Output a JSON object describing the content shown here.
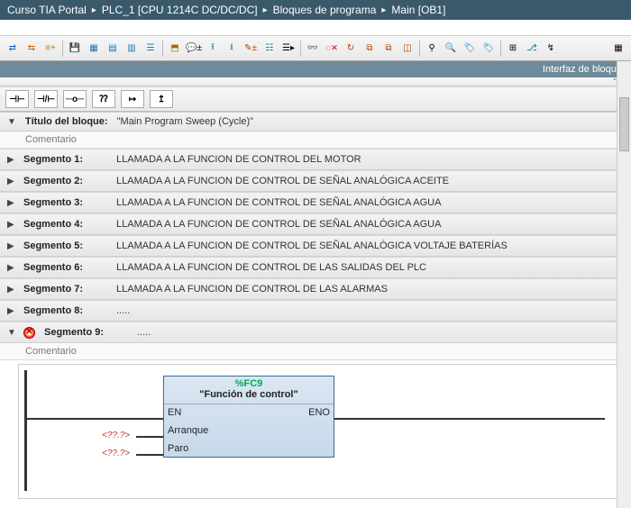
{
  "breadcrumb": {
    "items": [
      "Curso TIA Portal",
      "PLC_1 [CPU 1214C DC/DC/DC]",
      "Bloques de programa",
      "Main [OB1]"
    ]
  },
  "interfacebar": {
    "label": "Interfaz de bloque"
  },
  "instr_buttons": [
    "⊣⊢",
    "⊣/⊢",
    "─o─",
    "⁇",
    "↦",
    "↥"
  ],
  "block_title": {
    "label": "Título del bloque:",
    "value": "\"Main Program Sweep (Cycle)\"",
    "comment": "Comentario"
  },
  "segments": [
    {
      "name": "Segmento 1:",
      "desc": "LLAMADA A LA FUNCION DE CONTROL DEL  MOTOR",
      "expanded": false,
      "error": false
    },
    {
      "name": "Segmento 2:",
      "desc": "LLAMADA A LA FUNCION DE CONTROL DE SEÑAL ANALÓGICA ACEITE",
      "expanded": false,
      "error": false
    },
    {
      "name": "Segmento 3:",
      "desc": "LLAMADA A LA FUNCION DE CONTROL DE SEÑAL ANALÓGICA AGUA",
      "expanded": false,
      "error": false
    },
    {
      "name": "Segmento 4:",
      "desc": "LLAMADA A LA FUNCION DE CONTROL DE SEÑAL ANALÓGICA AGUA",
      "expanded": false,
      "error": false
    },
    {
      "name": "Segmento 5:",
      "desc": "LLAMADA A LA FUNCION DE CONTROL DE SEÑAL ANALÓGICA VOLTAJE BATERÍAS",
      "expanded": false,
      "error": false
    },
    {
      "name": "Segmento 6:",
      "desc": "LLAMADA A LA FUNCION DE CONTROL DE LAS SALIDAS DEL PLC",
      "expanded": false,
      "error": false
    },
    {
      "name": "Segmento 7:",
      "desc": "LLAMADA A LA FUNCION DE CONTROL DE LAS ALARMAS",
      "expanded": false,
      "error": false
    },
    {
      "name": "Segmento 8:",
      "desc": ".....",
      "expanded": false,
      "error": false
    },
    {
      "name": "Segmento 9:",
      "desc": ".....",
      "expanded": true,
      "error": true,
      "comment": "Comentario"
    }
  ],
  "fbd": {
    "symref": "%FC9",
    "title": "\"Función de control\"",
    "ports_left": [
      "EN",
      "Arranque",
      "Paro"
    ],
    "ports_right": [
      "ENO"
    ],
    "unk_tag": "<??.?>"
  }
}
